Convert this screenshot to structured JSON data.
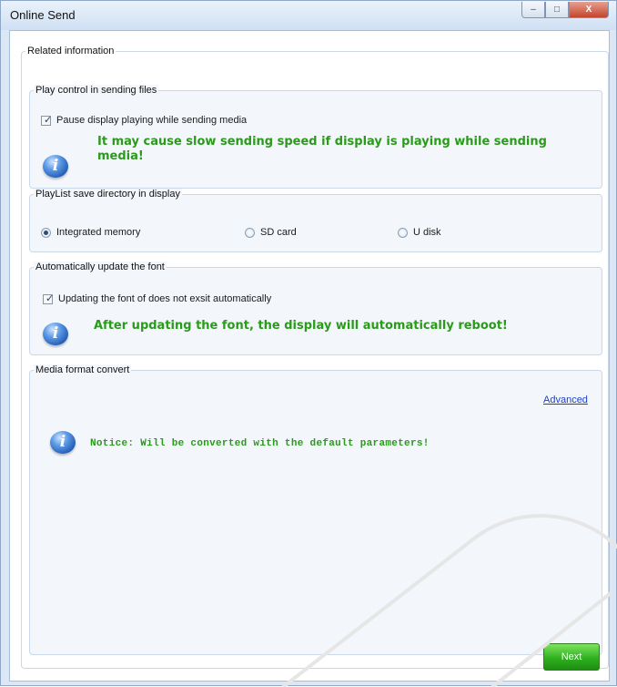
{
  "window": {
    "title": "Online Send",
    "controls": {
      "minimize": "–",
      "maximize": "□",
      "close": "X"
    }
  },
  "related": {
    "title": "Related information",
    "play_control": {
      "title": "Play control in sending files",
      "checkbox_label": "Pause display playing while sending media",
      "checked": true,
      "warning_line1": "It may cause slow sending speed if display is playing while sending",
      "warning_line2": "media!"
    },
    "playlist_dir": {
      "title": "PlayList save directory in display",
      "options": [
        {
          "label": "Integrated memory",
          "selected": true
        },
        {
          "label": "SD card",
          "selected": false
        },
        {
          "label": "U disk",
          "selected": false
        }
      ]
    },
    "font_update": {
      "title": "Automatically update the font",
      "checkbox_label": "Updating the font of does not exsit automatically",
      "checked": true,
      "warning": "After updating the font, the display will automatically reboot!"
    },
    "media_format": {
      "title": "Media format convert",
      "advanced_link": "Advanced",
      "notice": "Notice: Will be converted with the default parameters!"
    }
  },
  "footer": {
    "next_label": "Next"
  },
  "icons": {
    "info": "info-icon",
    "check": "✓",
    "info_glyph": "i"
  },
  "colors": {
    "warning_green": "#2a9a1a",
    "link_blue": "#1a3fd0",
    "next_green": "#2fb11f"
  }
}
